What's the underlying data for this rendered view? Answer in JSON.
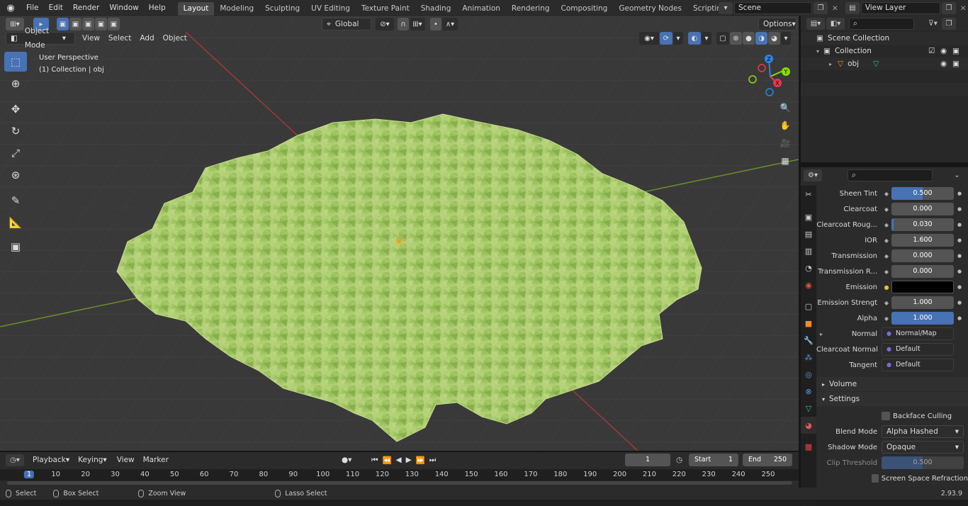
{
  "app": {
    "menus": [
      "File",
      "Edit",
      "Render",
      "Window",
      "Help"
    ],
    "workspaces": [
      "Layout",
      "Modeling",
      "Sculpting",
      "UV Editing",
      "Texture Paint",
      "Shading",
      "Animation",
      "Rendering",
      "Compositing",
      "Geometry Nodes",
      "Scripting"
    ],
    "active_workspace": "Layout",
    "scene": "Scene",
    "view_layer": "View Layer"
  },
  "viewport": {
    "mode": "Object Mode",
    "menus": [
      "View",
      "Select",
      "Add",
      "Object"
    ],
    "transform_orientation": "Global",
    "options_label": "Options",
    "perspective_label": "User Perspective",
    "collection_label": "(1) Collection | obj",
    "gizmo_axes": {
      "x": "X",
      "y": "Y",
      "z": "Z"
    }
  },
  "outliner": {
    "rows": [
      {
        "label": "Scene Collection"
      },
      {
        "label": "Collection"
      },
      {
        "label": "obj"
      }
    ]
  },
  "properties": {
    "rows": [
      {
        "label": "Sheen Tint",
        "value": "0.500",
        "fill": 0.5
      },
      {
        "label": "Clearcoat",
        "value": "0.000",
        "fill": 0
      },
      {
        "label": "Clearcoat Roug...",
        "value": "0.030",
        "fill": 0.03
      },
      {
        "label": "IOR",
        "value": "1.600",
        "fill": 0
      },
      {
        "label": "Transmission",
        "value": "0.000",
        "fill": 0
      },
      {
        "label": "Transmission R...",
        "value": "0.000",
        "fill": 0
      },
      {
        "label": "Emission",
        "value": "",
        "color": "#000000"
      },
      {
        "label": "Emission Strengt",
        "value": "1.000",
        "fill": 0
      },
      {
        "label": "Alpha",
        "value": "1.000",
        "fill": 1.0
      }
    ],
    "links": [
      {
        "label": "Normal",
        "value": "Normal/Map"
      },
      {
        "label": "Clearcoat Normal",
        "value": "Default"
      },
      {
        "label": "Tangent",
        "value": "Default"
      }
    ],
    "sections": {
      "volume": "Volume",
      "settings": "Settings"
    },
    "settings": {
      "backface_culling": "Backface Culling",
      "blend_mode_label": "Blend Mode",
      "blend_mode": "Alpha Hashed",
      "shadow_mode_label": "Shadow Mode",
      "shadow_mode": "Opaque",
      "clip_threshold_label": "Clip Threshold",
      "clip_threshold": "0.500",
      "clip_fill": 0.5,
      "screen_space_refraction": "Screen Space Refraction"
    }
  },
  "timeline": {
    "menus": [
      "Playback",
      "Keying",
      "View",
      "Marker"
    ],
    "current_frame": "1",
    "start_label": "Start",
    "start": "1",
    "end_label": "End",
    "end": "250",
    "ticks": [
      "1",
      "10",
      "20",
      "30",
      "40",
      "50",
      "60",
      "70",
      "80",
      "90",
      "100",
      "110",
      "120",
      "130",
      "140",
      "150",
      "160",
      "170",
      "180",
      "190",
      "200",
      "210",
      "220",
      "230",
      "240",
      "250"
    ]
  },
  "status": {
    "select": "Select",
    "box_select": "Box Select",
    "zoom_view": "Zoom View",
    "lasso_select": "Lasso Select",
    "version": "2.93.9"
  },
  "colors": {
    "accent": "#4772b3",
    "foliage": "#9cc25a"
  }
}
